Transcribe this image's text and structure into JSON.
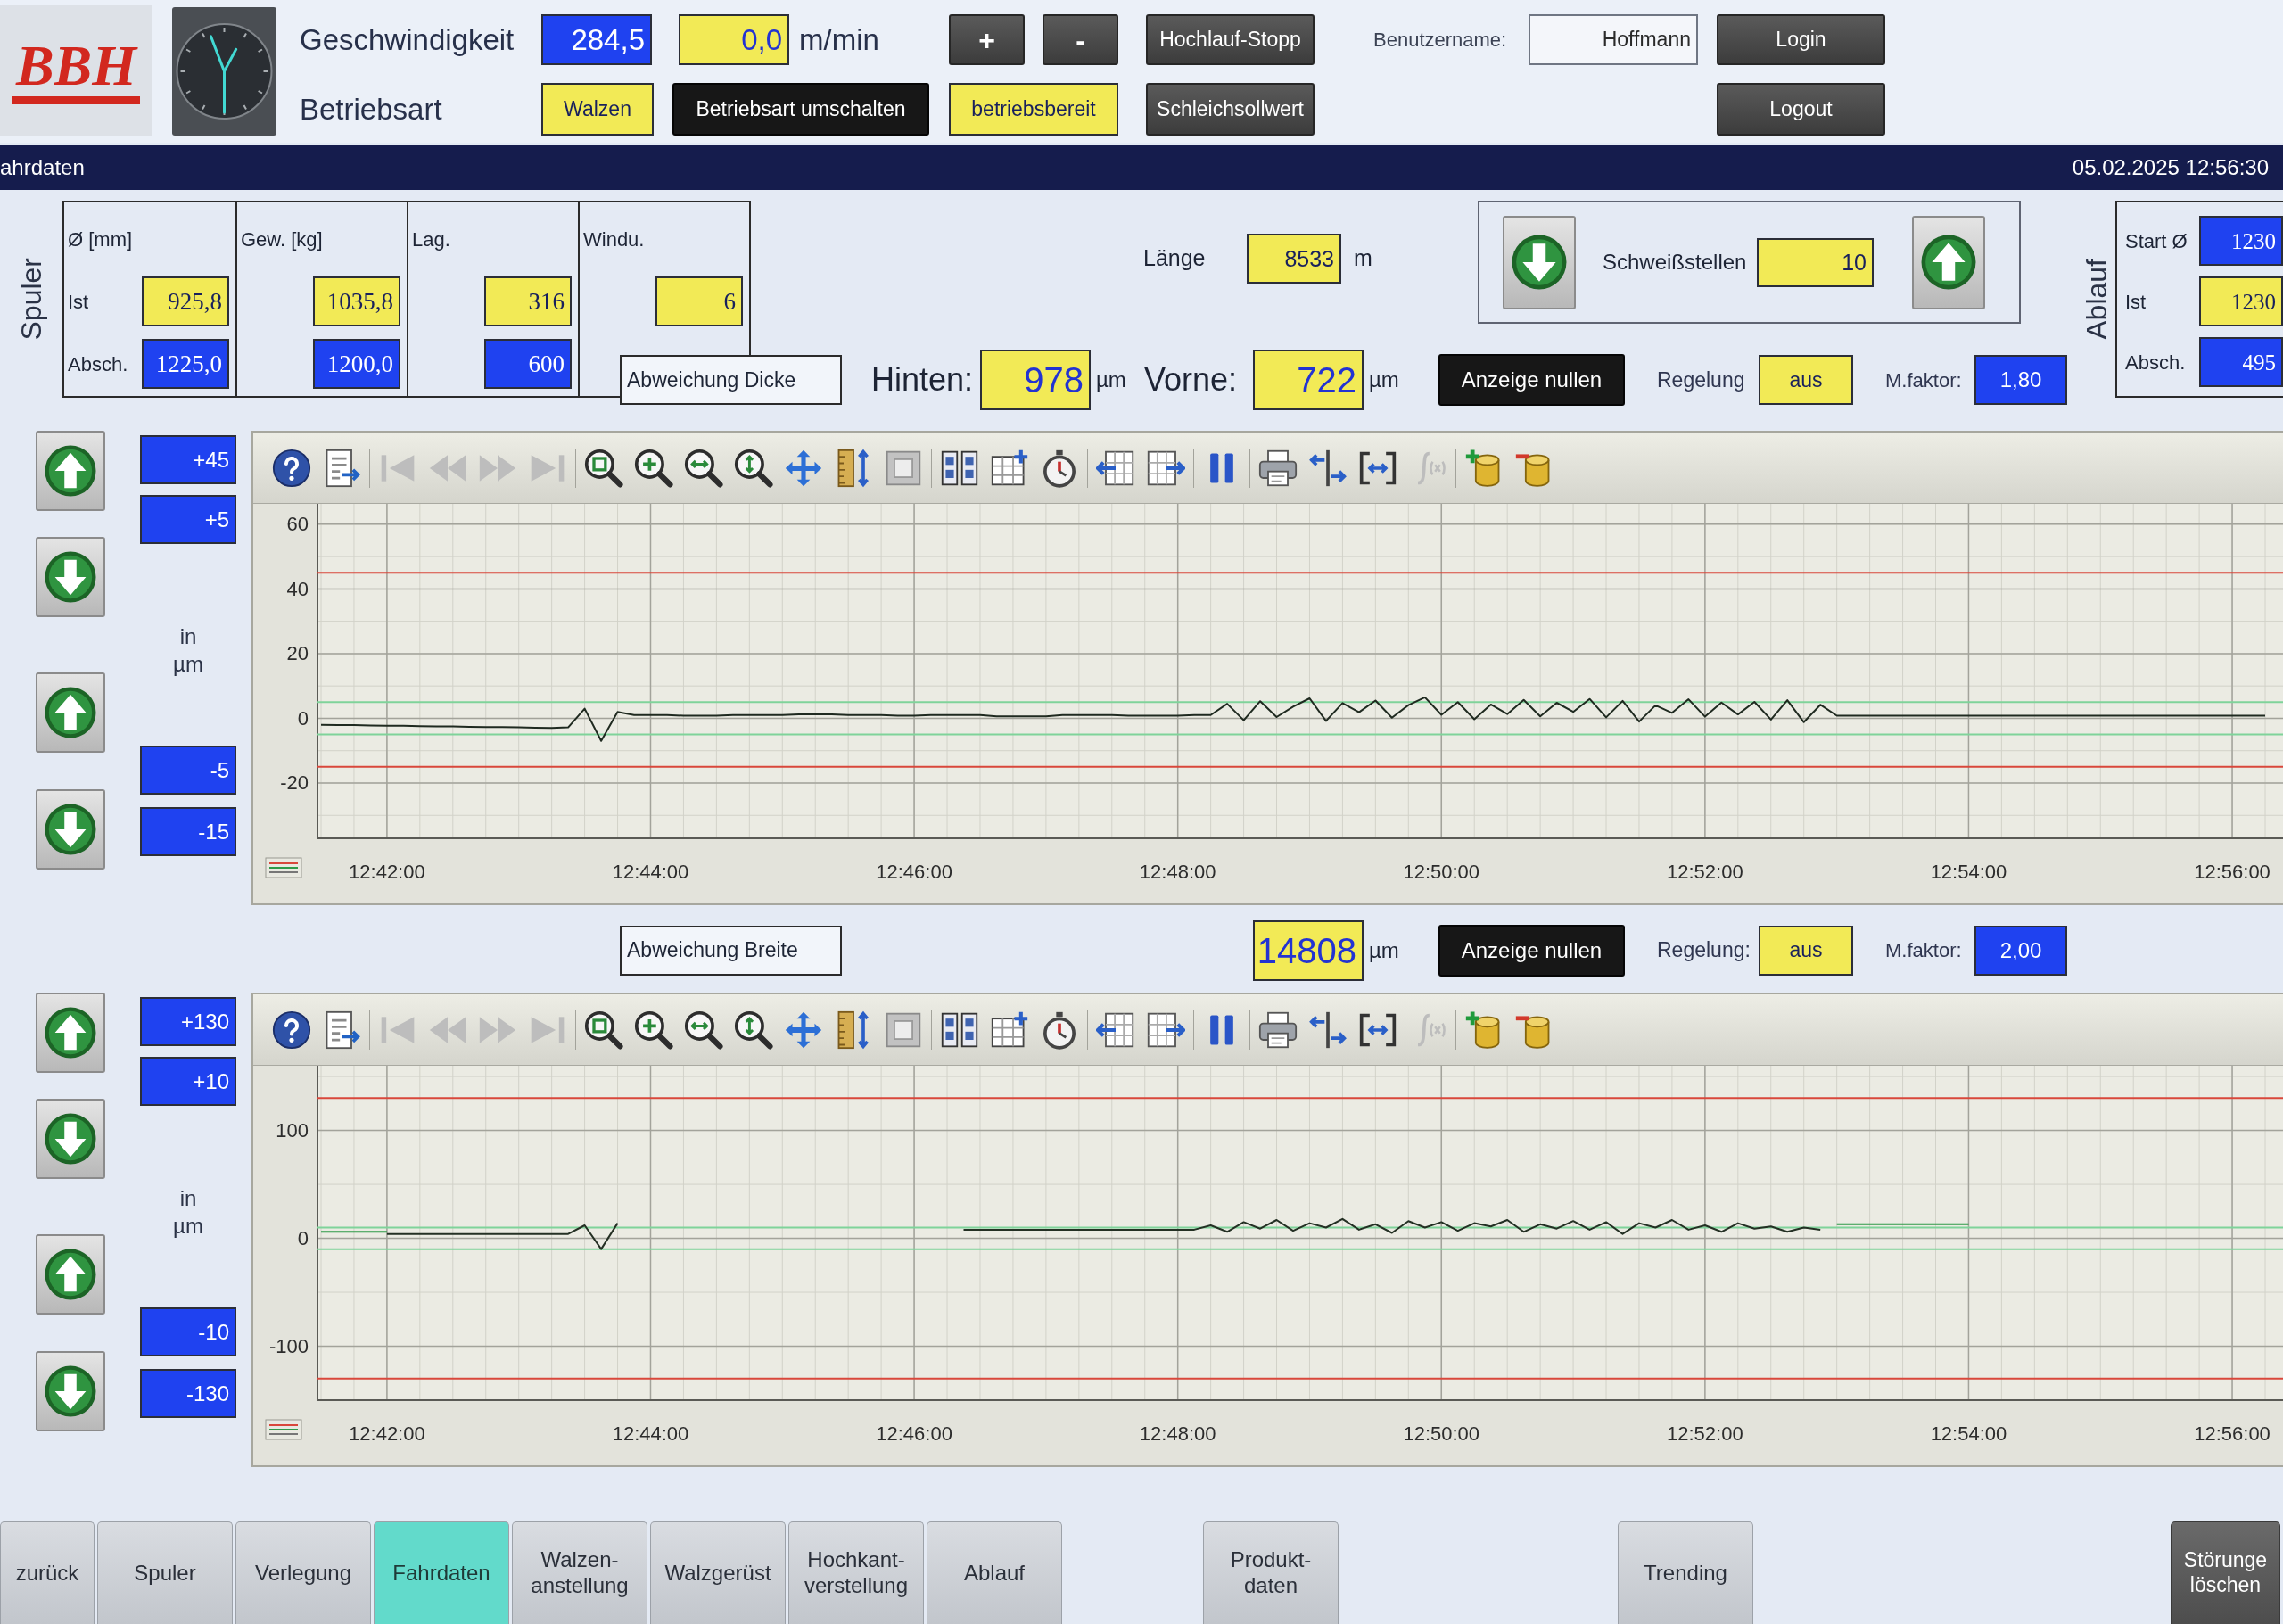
{
  "header": {
    "logo": "BBH",
    "speed": {
      "label": "Geschwindigkeit",
      "actual": {
        "value": "284,5",
        "kind": "input"
      },
      "target": {
        "value": "0,0",
        "kind": "display"
      },
      "unit": "m/min"
    },
    "increase_button": "+",
    "decrease_button": "-",
    "ramp_stop_button": "Hochlauf-Stopp",
    "user": {
      "label": "Benutzername:",
      "value": "Hoffmann"
    },
    "login_button": "Login",
    "mode": {
      "label": "Betriebsart",
      "current": {
        "value": "Walzen",
        "kind": "display"
      }
    },
    "mode_switch_button": "Betriebsart umschalten",
    "status": {
      "value": "betriebsbereit",
      "kind": "display"
    },
    "creep_speed_button": "Schleichsollwert",
    "logout_button": "Logout"
  },
  "title_bar": {
    "title": "ahrdaten",
    "datetime": "05.02.2025 12:56:30"
  },
  "coiler": {
    "label": "Spuler",
    "row_labels": [
      "Ist",
      "Absch."
    ],
    "columns": [
      {
        "heading": "Ø [mm]",
        "actual": {
          "value": "925,8",
          "kind": "display"
        },
        "cutoff": {
          "value": "1225,0",
          "kind": "input"
        }
      },
      {
        "heading": "Gew. [kg]",
        "actual": {
          "value": "1035,8",
          "kind": "display"
        },
        "cutoff": {
          "value": "1200,0",
          "kind": "input"
        }
      },
      {
        "heading": "Lag.",
        "actual": {
          "value": "316",
          "kind": "display"
        },
        "cutoff": {
          "value": "600",
          "kind": "input"
        }
      },
      {
        "heading": "Windu.",
        "actual": {
          "value": "6",
          "kind": "display"
        }
      }
    ]
  },
  "length": {
    "label": "Länge",
    "reading": {
      "value": "8533",
      "kind": "display"
    },
    "unit": "m"
  },
  "welds": {
    "label": "Schweißstellen",
    "reading": {
      "value": "10",
      "kind": "display"
    }
  },
  "payoff": {
    "label": "Ablauf",
    "rows": [
      {
        "label": "Start Ø",
        "field": {
          "value": "1230",
          "kind": "input"
        }
      },
      {
        "label": "Ist",
        "field": {
          "value": "1230",
          "kind": "display"
        }
      },
      {
        "label": "Absch.",
        "field": {
          "value": "495",
          "kind": "input"
        }
      }
    ]
  },
  "thickness": {
    "heading": "Abweichung Dicke",
    "readings": [
      {
        "label": "Hinten:",
        "field": {
          "value": "978",
          "kind": "display"
        },
        "unit": "µm"
      },
      {
        "label": "Vorne:",
        "field": {
          "value": "722",
          "kind": "display"
        },
        "unit": "µm"
      }
    ],
    "zero_button": "Anzeige nullen",
    "control": {
      "label": "Regelung",
      "field": {
        "value": "aus",
        "kind": "display"
      }
    },
    "factor": {
      "label": "M.faktor:",
      "field": {
        "value": "1,80",
        "kind": "input"
      }
    },
    "upper_limits": [
      {
        "value": "+45",
        "kind": "input"
      },
      {
        "value": "+5",
        "kind": "input"
      }
    ],
    "unit": "in µm",
    "lower_limits": [
      {
        "value": "-5",
        "kind": "input"
      },
      {
        "value": "-15",
        "kind": "input"
      }
    ],
    "toolbar": [
      {
        "tools": [
          {
            "kind": "help",
            "disabled": false
          },
          {
            "kind": "properties",
            "disabled": false
          }
        ]
      },
      {
        "tools": [
          {
            "kind": "first",
            "disabled": true
          },
          {
            "kind": "previous",
            "disabled": true
          },
          {
            "kind": "next",
            "disabled": true
          },
          {
            "kind": "last",
            "disabled": true
          }
        ]
      },
      {
        "tools": [
          {
            "kind": "zoom_area",
            "disabled": false
          },
          {
            "kind": "zoom_in",
            "disabled": false
          },
          {
            "kind": "zoom_x",
            "disabled": false
          },
          {
            "kind": "zoom_y",
            "disabled": false
          },
          {
            "kind": "pan",
            "disabled": false
          },
          {
            "kind": "ruler",
            "disabled": false
          },
          {
            "kind": "original_size",
            "disabled": false
          }
        ]
      },
      {
        "tools": [
          {
            "kind": "table",
            "disabled": false
          },
          {
            "kind": "grid",
            "disabled": false
          },
          {
            "kind": "stopwatch",
            "disabled": false
          }
        ]
      },
      {
        "tools": [
          {
            "kind": "shift_left",
            "disabled": false
          },
          {
            "kind": "shift_right",
            "disabled": false
          }
        ]
      },
      {
        "tools": [
          {
            "kind": "pause",
            "disabled": false
          }
        ]
      },
      {
        "tools": [
          {
            "kind": "print",
            "disabled": false
          },
          {
            "kind": "axis",
            "disabled": false
          },
          {
            "kind": "bracket",
            "disabled": false
          },
          {
            "kind": "integral",
            "disabled": true
          }
        ]
      },
      {
        "tools": [
          {
            "kind": "db_add",
            "disabled": false
          },
          {
            "kind": "db_remove",
            "disabled": false
          }
        ]
      }
    ],
    "chart_data": {
      "type": "line",
      "grid": true,
      "categories": [
        null,
        null,
        null,
        null,
        "12:42:00",
        null,
        null,
        null,
        null,
        null,
        null,
        null,
        null,
        null,
        null,
        null,
        null,
        null,
        null,
        null,
        "12:44:00",
        null,
        null,
        null,
        null,
        null,
        null,
        null,
        null,
        null,
        null,
        null,
        null,
        null,
        null,
        null,
        "12:46:00",
        null,
        null,
        null,
        null,
        null,
        null,
        null,
        null,
        null,
        null,
        null,
        null,
        null,
        null,
        null,
        "12:48:00",
        null,
        null,
        null,
        null,
        null,
        null,
        null,
        null,
        null,
        null,
        null,
        null,
        null,
        null,
        null,
        "12:50:00",
        null,
        null,
        null,
        null,
        null,
        null,
        null,
        null,
        null,
        null,
        null,
        null,
        null,
        null,
        null,
        "12:52:00",
        null,
        null,
        null,
        null,
        null,
        null,
        null,
        null,
        null,
        null,
        null,
        null,
        null,
        null,
        null,
        "12:54:00",
        null,
        null,
        null,
        null,
        null,
        null,
        null,
        null,
        null,
        null,
        null,
        null,
        null,
        null,
        null,
        "12:56:00",
        null,
        null
      ],
      "ylim": [
        -37.1,
        66.3
      ],
      "yticks": [
        60,
        40,
        20,
        0,
        -20
      ],
      "ref_lines": [
        {
          "axis": "y",
          "value": 45,
          "color": "#d9473b"
        },
        {
          "axis": "y",
          "value": 5,
          "color": "#7fd39a"
        },
        {
          "axis": "y",
          "value": -5,
          "color": "#7fd39a"
        },
        {
          "axis": "y",
          "value": -15,
          "color": "#d9473b"
        }
      ],
      "series": [
        {
          "color": "#1f2a20",
          "values": [
            -2,
            -2.1,
            -2.1,
            -2.2,
            -2.3,
            -2.3,
            -2.4,
            -2.5,
            -2.5,
            -2.6,
            -2.7,
            -2.7,
            -2.8,
            -2.9,
            -3,
            -2.8,
            3,
            -7,
            2,
            1,
            1,
            1,
            0.8,
            0.8,
            0.8,
            1,
            1,
            1,
            1,
            1.2,
            1.2,
            1.2,
            1,
            1,
            1,
            0.8,
            0.8,
            1,
            1,
            1,
            1,
            0.6,
            0.6,
            0.6,
            0.6,
            1,
            1,
            1,
            1,
            0.8,
            0.8,
            0.8,
            0.8,
            1,
            1.0,
            4.5,
            -0.6,
            5.3,
            0.4,
            3.6,
            6.2,
            -0.8,
            4.7,
            1.9,
            5.5,
            0.2,
            4.1,
            6.5,
            1.1,
            5.0,
            -0.3,
            4.3,
            1.3,
            5.7,
            0.6,
            4.8,
            2.0,
            6.0,
            0.3,
            5.4,
            -1.0,
            4.0,
            1.7,
            5.9,
            0.5,
            4.9,
            1.2,
            5.1,
            -0.4,
            5.6,
            -1.2,
            4.2,
            0.8,
            0.8,
            0.8,
            0.8,
            0.8,
            0.8,
            0.8,
            0.8,
            0.8,
            0.8,
            0.8,
            0.8,
            0.8,
            0.8,
            0.8,
            0.8,
            0.8,
            0.8,
            0.8,
            0.8,
            0.8,
            0.8,
            0.8,
            0.8,
            0.8,
            0.8,
            0.8
          ]
        }
      ]
    }
  },
  "width": {
    "heading": "Abweichung Breite",
    "readings": [
      {
        "field": {
          "value": "14808",
          "kind": "display"
        },
        "unit": "µm"
      }
    ],
    "zero_button": "Anzeige nullen",
    "control": {
      "label": "Regelung:",
      "field": {
        "value": "aus",
        "kind": "display"
      }
    },
    "factor": {
      "label": "M.faktor:",
      "field": {
        "value": "2,00",
        "kind": "input"
      }
    },
    "upper_limits": [
      {
        "value": "+130",
        "kind": "input"
      },
      {
        "value": "+10",
        "kind": "input"
      }
    ],
    "unit": "in µm",
    "lower_limits": [
      {
        "value": "-10",
        "kind": "input"
      },
      {
        "value": "-130",
        "kind": "input"
      }
    ],
    "toolbar": [
      {
        "tools": [
          {
            "kind": "help",
            "disabled": false
          },
          {
            "kind": "properties",
            "disabled": false
          }
        ]
      },
      {
        "tools": [
          {
            "kind": "first",
            "disabled": true
          },
          {
            "kind": "previous",
            "disabled": true
          },
          {
            "kind": "next",
            "disabled": true
          },
          {
            "kind": "last",
            "disabled": true
          }
        ]
      },
      {
        "tools": [
          {
            "kind": "zoom_area",
            "disabled": false
          },
          {
            "kind": "zoom_in",
            "disabled": false
          },
          {
            "kind": "zoom_x",
            "disabled": false
          },
          {
            "kind": "zoom_y",
            "disabled": false
          },
          {
            "kind": "pan",
            "disabled": false
          },
          {
            "kind": "ruler",
            "disabled": false
          },
          {
            "kind": "original_size",
            "disabled": false
          }
        ]
      },
      {
        "tools": [
          {
            "kind": "table",
            "disabled": false
          },
          {
            "kind": "grid",
            "disabled": false
          },
          {
            "kind": "stopwatch",
            "disabled": false
          }
        ]
      },
      {
        "tools": [
          {
            "kind": "shift_left",
            "disabled": false
          },
          {
            "kind": "shift_right",
            "disabled": false
          }
        ]
      },
      {
        "tools": [
          {
            "kind": "pause",
            "disabled": false
          }
        ]
      },
      {
        "tools": [
          {
            "kind": "print",
            "disabled": false
          },
          {
            "kind": "axis",
            "disabled": false
          },
          {
            "kind": "bracket",
            "disabled": false
          },
          {
            "kind": "integral",
            "disabled": true
          }
        ]
      },
      {
        "tools": [
          {
            "kind": "db_add",
            "disabled": false
          },
          {
            "kind": "db_remove",
            "disabled": false
          }
        ]
      }
    ],
    "chart_data": {
      "type": "line",
      "grid": true,
      "categories": [
        null,
        null,
        null,
        null,
        "12:42:00",
        null,
        null,
        null,
        null,
        null,
        null,
        null,
        null,
        null,
        null,
        null,
        null,
        null,
        null,
        null,
        "12:44:00",
        null,
        null,
        null,
        null,
        null,
        null,
        null,
        null,
        null,
        null,
        null,
        null,
        null,
        null,
        null,
        "12:46:00",
        null,
        null,
        null,
        null,
        null,
        null,
        null,
        null,
        null,
        null,
        null,
        null,
        null,
        null,
        null,
        "12:48:00",
        null,
        null,
        null,
        null,
        null,
        null,
        null,
        null,
        null,
        null,
        null,
        null,
        null,
        null,
        null,
        "12:50:00",
        null,
        null,
        null,
        null,
        null,
        null,
        null,
        null,
        null,
        null,
        null,
        null,
        null,
        null,
        null,
        "12:52:00",
        null,
        null,
        null,
        null,
        null,
        null,
        null,
        null,
        null,
        null,
        null,
        null,
        null,
        null,
        null,
        "12:54:00",
        null,
        null,
        null,
        null,
        null,
        null,
        null,
        null,
        null,
        null,
        null,
        null,
        null,
        null,
        null,
        "12:56:00",
        null,
        null
      ],
      "ylim": [
        -150,
        160
      ],
      "yticks": [
        100,
        0,
        -100
      ],
      "ref_lines": [
        {
          "axis": "y",
          "value": 130,
          "color": "#d9473b"
        },
        {
          "axis": "y",
          "value": 10,
          "color": "#7fd39a"
        },
        {
          "axis": "y",
          "value": -10,
          "color": "#7fd39a"
        },
        {
          "axis": "y",
          "value": -130,
          "color": "#d9473b"
        }
      ],
      "series": [
        {
          "color": "#243024",
          "values": [
            null,
            null,
            null,
            null,
            4,
            4,
            4,
            4,
            4,
            4,
            4,
            4,
            4,
            4,
            4,
            4,
            12,
            -10,
            14,
            null,
            null,
            null,
            null,
            null,
            null,
            null,
            null,
            null,
            null,
            null,
            null,
            null,
            null,
            null,
            null,
            null,
            null,
            null,
            null,
            8,
            8,
            8,
            8,
            8,
            8,
            8,
            8,
            8,
            8,
            8,
            8,
            8,
            8,
            8,
            12,
            6,
            15,
            9,
            17,
            7,
            14,
            10,
            18,
            8,
            13,
            5,
            16,
            10,
            15,
            7,
            14,
            11,
            17,
            6,
            13,
            9,
            16,
            8,
            15,
            4,
            14,
            10,
            17,
            8,
            12,
            6,
            14,
            9,
            11,
            6,
            10,
            8,
            null,
            null,
            null,
            null,
            null,
            null,
            null,
            null,
            null,
            null,
            null,
            null,
            null,
            null,
            null,
            null,
            null,
            null,
            null,
            null,
            null,
            null,
            null,
            null,
            null,
            null,
            null
          ]
        },
        {
          "color": "#2f9a48",
          "values": [
            6,
            6,
            6,
            6,
            6,
            null,
            null,
            null,
            null,
            null,
            null,
            null,
            null,
            null,
            null,
            null,
            null,
            null,
            null,
            null,
            null,
            null,
            null,
            null,
            null,
            null,
            null,
            null,
            null,
            null,
            null,
            null,
            null,
            null,
            null,
            null,
            null,
            null,
            null,
            null,
            null,
            null,
            null,
            null,
            null,
            null,
            null,
            null,
            null,
            null,
            null,
            null,
            null,
            null,
            null,
            null,
            null,
            null,
            null,
            null,
            null,
            null,
            null,
            null,
            null,
            null,
            null,
            null,
            null,
            null,
            null,
            null,
            null,
            null,
            null,
            null,
            null,
            null,
            null,
            null,
            null,
            null,
            null,
            null,
            null,
            null,
            null,
            null,
            null,
            null,
            null,
            null,
            13,
            13,
            13,
            13,
            13,
            13,
            13,
            13,
            13,
            null,
            null,
            null,
            null,
            null,
            null,
            null,
            null,
            null,
            null,
            null,
            null,
            null,
            null,
            null,
            null,
            null,
            null
          ]
        }
      ]
    }
  },
  "nav_tabs": [
    {
      "label": "zurück",
      "selected": false
    },
    {
      "label": "Spuler",
      "selected": false
    },
    {
      "label": "Verlegung",
      "selected": false
    },
    {
      "label": "Fahrdaten",
      "selected": true
    },
    {
      "label": "Walzen-\nanstellung",
      "selected": false
    },
    {
      "label": "Walzgerüst",
      "selected": false
    },
    {
      "label": "Hochkant-\nverstellung",
      "selected": false
    },
    {
      "label": "Ablauf",
      "selected": false
    },
    {
      "label": "Produkt-\ndaten",
      "selected": false
    },
    {
      "label": "Trending",
      "selected": false
    }
  ],
  "fault_reset_button": "Störunge\nlöschen"
}
